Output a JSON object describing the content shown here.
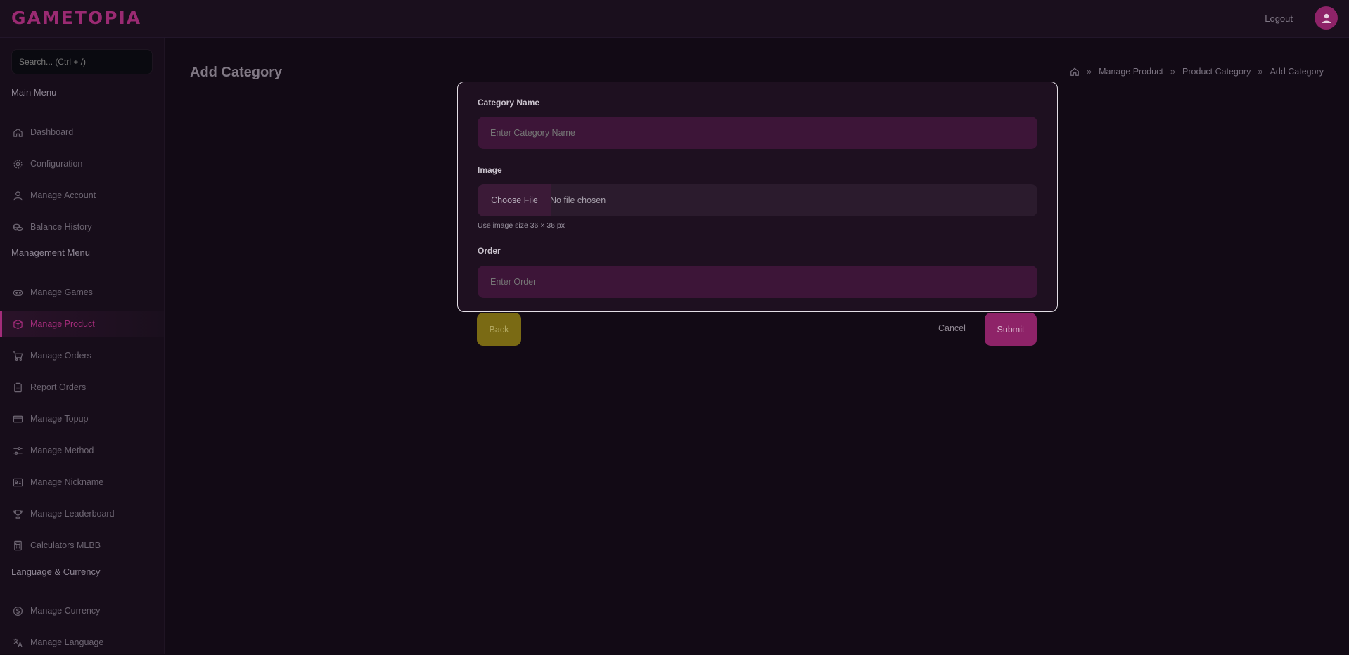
{
  "header": {
    "logo": "GAMETOPIA",
    "logout_label": "Logout",
    "brand_color": "#9a2a72"
  },
  "sidebar": {
    "search_placeholder": "Search... (Ctrl + /)",
    "main_menu_title": "Main Menu",
    "main_menu": [
      {
        "label": "Dashboard",
        "icon": "home-icon"
      },
      {
        "label": "Configuration",
        "icon": "gear-icon"
      },
      {
        "label": "Manage Account",
        "icon": "user-icon"
      },
      {
        "label": "Balance History",
        "icon": "coins-icon"
      }
    ],
    "management_menu_title": "Management Menu",
    "management_menu": [
      {
        "label": "Manage Games",
        "icon": "gamepad-icon"
      },
      {
        "label": "Manage Product",
        "icon": "box-icon",
        "active": true
      },
      {
        "label": "Manage Orders",
        "icon": "cart-icon"
      },
      {
        "label": "Report Orders",
        "icon": "clipboard-icon"
      },
      {
        "label": "Manage Topup",
        "icon": "card-icon"
      },
      {
        "label": "Manage Method",
        "icon": "sliders-icon"
      },
      {
        "label": "Manage Nickname",
        "icon": "id-card-icon"
      },
      {
        "label": "Manage Leaderboard",
        "icon": "trophy-icon"
      },
      {
        "label": "Calculators MLBB",
        "icon": "calculator-icon"
      }
    ],
    "language_menu_title": "Language & Currency",
    "language_menu": [
      {
        "label": "Manage Currency",
        "icon": "dollar-circle-icon"
      },
      {
        "label": "Manage Language",
        "icon": "translate-icon"
      }
    ]
  },
  "main": {
    "title": "Add Category",
    "breadcrumb": [
      "Manage Product",
      "Product Category",
      "Add Category"
    ],
    "breadcrumb_separator": "»"
  },
  "form": {
    "category_name_label": "Category Name",
    "category_name_placeholder": "Enter Category Name",
    "category_name_value": "",
    "image_label": "Image",
    "choose_file_label": "Choose File",
    "no_file_text": "No file chosen",
    "image_hint": "Use image size 36 × 36 px",
    "order_label": "Order",
    "order_placeholder": "Enter Order",
    "order_value": ""
  },
  "actions": {
    "back_label": "Back",
    "cancel_label": "Cancel",
    "submit_label": "Submit",
    "back_color": "#7a6a14",
    "submit_color": "#8e2368"
  }
}
